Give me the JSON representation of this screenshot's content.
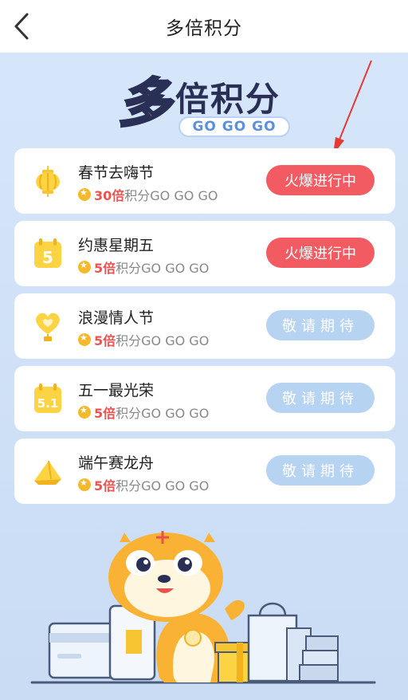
{
  "nav": {
    "title": "多倍积分"
  },
  "hero": {
    "big": "多",
    "title": "倍积分",
    "subtitle": "GO GO GO"
  },
  "cards": [
    {
      "title": "春节去嗨节",
      "multiplier": "30倍",
      "tail": "积分GO GO GO",
      "button": "火爆进行中",
      "status": "hot",
      "icon": "lantern-icon"
    },
    {
      "title": "约惠星期五",
      "multiplier": "5倍",
      "tail": "积分GO GO GO",
      "button": "火爆进行中",
      "status": "hot",
      "icon": "calendar-5-icon"
    },
    {
      "title": "浪漫情人节",
      "multiplier": "5倍",
      "tail": "积分GO GO GO",
      "button": "敬请期待",
      "status": "soon",
      "icon": "heart-balloon-icon"
    },
    {
      "title": "五一最光荣",
      "multiplier": "5倍",
      "tail": "积分GO GO GO",
      "button": "敬请期待",
      "status": "soon",
      "icon": "calendar-51-icon"
    },
    {
      "title": "端午赛龙舟",
      "multiplier": "5倍",
      "tail": "积分GO GO GO",
      "button": "敬请期待",
      "status": "soon",
      "icon": "zongzi-icon"
    }
  ],
  "colors": {
    "accent": "#f15b61",
    "pending": "#b7d3f2",
    "gold": "#f6b92b",
    "background": "#cfe1f7"
  }
}
